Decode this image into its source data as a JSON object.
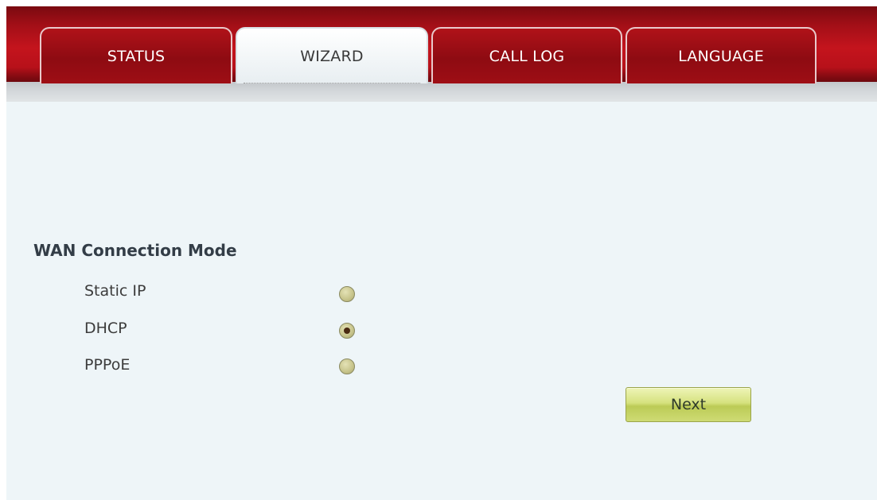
{
  "nav": {
    "tabs": [
      {
        "label": "STATUS",
        "active": false
      },
      {
        "label": "WIZARD",
        "active": true
      },
      {
        "label": "CALL LOG",
        "active": false
      },
      {
        "label": "LANGUAGE",
        "active": false
      }
    ]
  },
  "wan": {
    "title": "WAN Connection Mode",
    "options": [
      {
        "label": "Static IP",
        "selected": false
      },
      {
        "label": "DHCP",
        "selected": true
      },
      {
        "label": "PPPoE",
        "selected": false
      }
    ],
    "next_label": "Next"
  },
  "colors": {
    "header_red": "#b8111a",
    "content_bg": "#eef5f8",
    "button_green": "#d6e27e"
  }
}
